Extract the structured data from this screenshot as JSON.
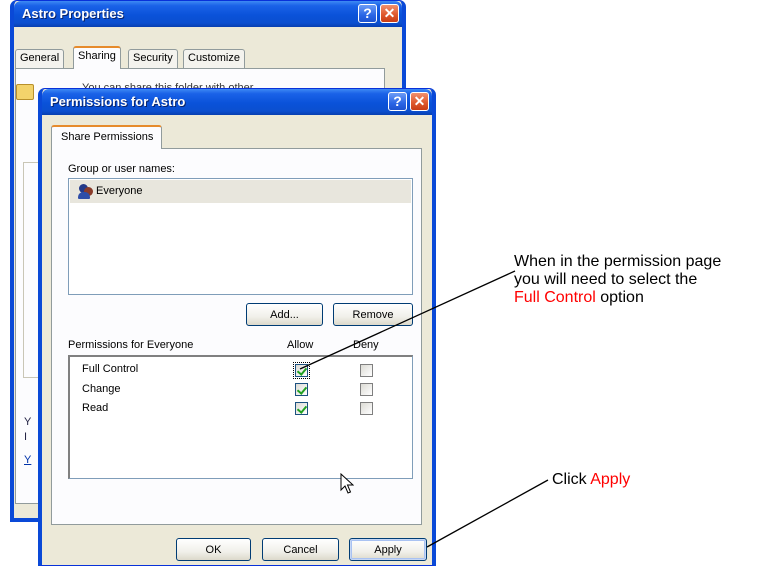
{
  "astro_window": {
    "title": "Astro Properties",
    "help_glyph": "?",
    "close_glyph": "✕",
    "tabs": [
      {
        "label": "General"
      },
      {
        "label": "Sharing",
        "active": true
      },
      {
        "label": "Security"
      },
      {
        "label": "Customize"
      }
    ],
    "partial_text": "You can share this folder with other",
    "partial_letters": [
      "Y",
      "I",
      "Y"
    ]
  },
  "permissions_dialog": {
    "title": "Permissions for Astro",
    "help_glyph": "?",
    "close_glyph": "✕",
    "tab_label": "Share Permissions",
    "group_label": "Group or user names:",
    "users": [
      {
        "name": "Everyone",
        "icon": "users-group-icon",
        "selected": true
      }
    ],
    "add_button": "Add...",
    "remove_button": "Remove",
    "permissions_header": "Permissions for Everyone",
    "allow_header": "Allow",
    "deny_header": "Deny",
    "permissions": [
      {
        "name": "Full Control",
        "allow": true,
        "deny": false
      },
      {
        "name": "Change",
        "allow": true,
        "deny": false
      },
      {
        "name": "Read",
        "allow": true,
        "deny": false
      }
    ],
    "ok_button": "OK",
    "cancel_button": "Cancel",
    "apply_button": "Apply"
  },
  "annotations": {
    "permission_note": {
      "line1": "When in the permission page",
      "line2": "you will need to select the",
      "highlight": "Full Control",
      "tail": " option"
    },
    "apply_note": {
      "prefix": "Click ",
      "highlight": "Apply"
    }
  },
  "colors": {
    "titlebar_blue": "#0a52d9",
    "annotation_red": "#ff0000",
    "checkmark_green": "#21a121"
  }
}
